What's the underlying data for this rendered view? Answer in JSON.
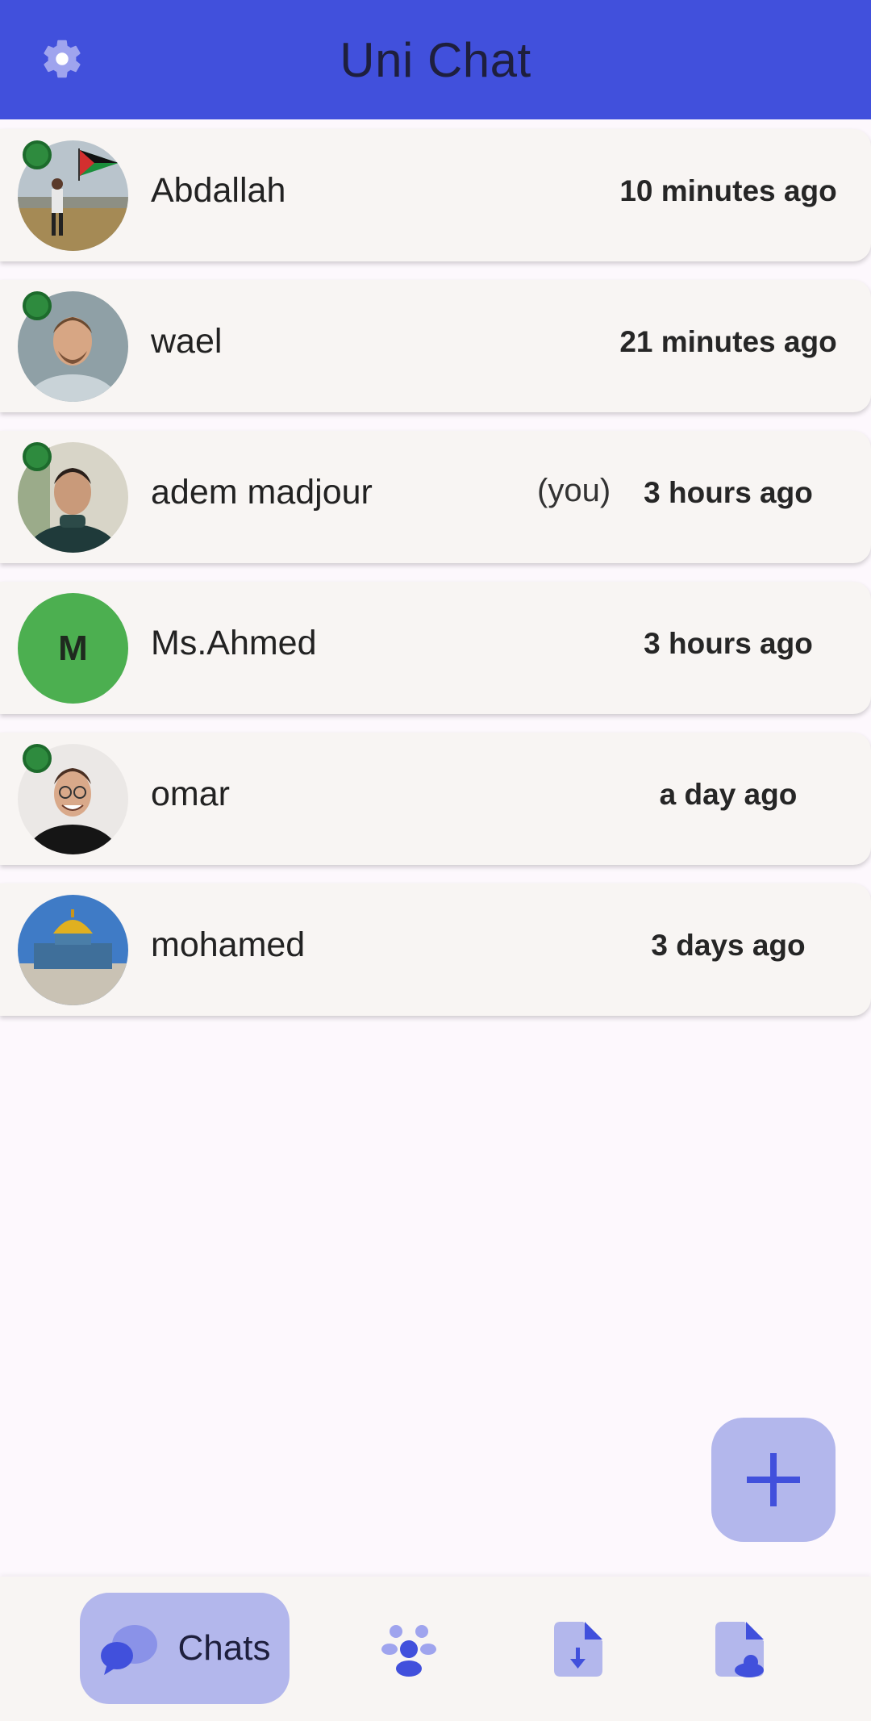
{
  "app": {
    "title": "Uni Chat"
  },
  "colors": {
    "primary": "#4150dc",
    "secondary_container": "#b3b7ec",
    "online": "#2e8b3e",
    "list_bg": "#f8f5f3",
    "page_bg": "#fdf8fd"
  },
  "icons": {
    "settings": "gear-icon",
    "add": "plus-icon",
    "nav_chats": "chat-bubbles-icon",
    "nav_groups": "groups-icon",
    "nav_downloads": "file-download-icon",
    "nav_cloud": "file-cloud-icon"
  },
  "chats": [
    {
      "name": "Abdallah",
      "time": "10 minutes ago",
      "online": true,
      "avatar": "photo"
    },
    {
      "name": "wael",
      "time": "21 minutes ago",
      "online": true,
      "avatar": "photo"
    },
    {
      "name": "adem madjour",
      "you_label": "(you)",
      "time": "3 hours ago",
      "online": true,
      "avatar": "photo"
    },
    {
      "name": "Ms.Ahmed",
      "time": "3 hours ago",
      "online": false,
      "avatar": "letter",
      "avatar_letter": "M"
    },
    {
      "name": "omar",
      "time": "a day ago",
      "online": true,
      "avatar": "photo"
    },
    {
      "name": "mohamed",
      "time": "3 days ago",
      "online": false,
      "avatar": "photo"
    }
  ],
  "bottom_nav": {
    "chats_label": "Chats",
    "selected": "chats"
  }
}
